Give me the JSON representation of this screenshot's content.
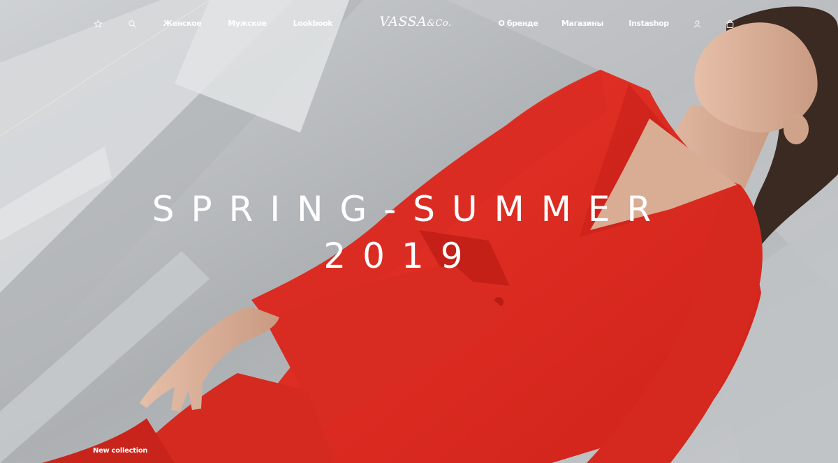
{
  "brand": {
    "logo_main": "VASSA",
    "logo_amp": "&Co."
  },
  "nav": {
    "favorites_icon": "star-icon",
    "search_icon": "search-icon",
    "left_items": [
      "Женское",
      "Мужское",
      "Lookbook"
    ],
    "right_items": [
      "О бренде",
      "Магазины",
      "Instashop"
    ],
    "account_icon": "user-icon",
    "cart_icon": "shopping-bag-icon"
  },
  "hero": {
    "headline_line1": "SPRING-SUMMER",
    "headline_line2": "2019",
    "collection_label": "New collection"
  },
  "colors": {
    "suit_red": "#e0281f",
    "text": "#ffffff",
    "background_gray": "#b8bbbe"
  }
}
